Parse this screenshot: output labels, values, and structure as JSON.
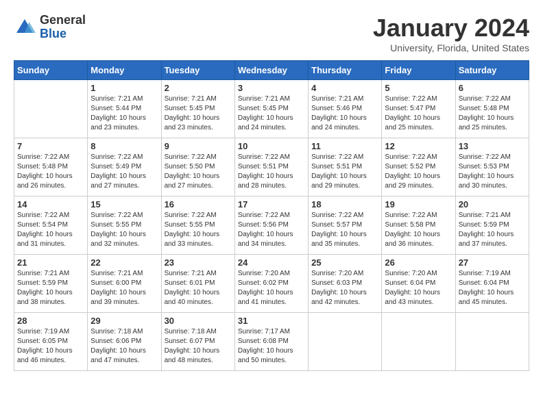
{
  "logo": {
    "general": "General",
    "blue": "Blue"
  },
  "header": {
    "title": "January 2024",
    "subtitle": "University, Florida, United States"
  },
  "days_of_week": [
    "Sunday",
    "Monday",
    "Tuesday",
    "Wednesday",
    "Thursday",
    "Friday",
    "Saturday"
  ],
  "weeks": [
    [
      {
        "day": "",
        "info": ""
      },
      {
        "day": "1",
        "info": "Sunrise: 7:21 AM\nSunset: 5:44 PM\nDaylight: 10 hours\nand 23 minutes."
      },
      {
        "day": "2",
        "info": "Sunrise: 7:21 AM\nSunset: 5:45 PM\nDaylight: 10 hours\nand 23 minutes."
      },
      {
        "day": "3",
        "info": "Sunrise: 7:21 AM\nSunset: 5:45 PM\nDaylight: 10 hours\nand 24 minutes."
      },
      {
        "day": "4",
        "info": "Sunrise: 7:21 AM\nSunset: 5:46 PM\nDaylight: 10 hours\nand 24 minutes."
      },
      {
        "day": "5",
        "info": "Sunrise: 7:22 AM\nSunset: 5:47 PM\nDaylight: 10 hours\nand 25 minutes."
      },
      {
        "day": "6",
        "info": "Sunrise: 7:22 AM\nSunset: 5:48 PM\nDaylight: 10 hours\nand 25 minutes."
      }
    ],
    [
      {
        "day": "7",
        "info": "Sunrise: 7:22 AM\nSunset: 5:48 PM\nDaylight: 10 hours\nand 26 minutes."
      },
      {
        "day": "8",
        "info": "Sunrise: 7:22 AM\nSunset: 5:49 PM\nDaylight: 10 hours\nand 27 minutes."
      },
      {
        "day": "9",
        "info": "Sunrise: 7:22 AM\nSunset: 5:50 PM\nDaylight: 10 hours\nand 27 minutes."
      },
      {
        "day": "10",
        "info": "Sunrise: 7:22 AM\nSunset: 5:51 PM\nDaylight: 10 hours\nand 28 minutes."
      },
      {
        "day": "11",
        "info": "Sunrise: 7:22 AM\nSunset: 5:51 PM\nDaylight: 10 hours\nand 29 minutes."
      },
      {
        "day": "12",
        "info": "Sunrise: 7:22 AM\nSunset: 5:52 PM\nDaylight: 10 hours\nand 29 minutes."
      },
      {
        "day": "13",
        "info": "Sunrise: 7:22 AM\nSunset: 5:53 PM\nDaylight: 10 hours\nand 30 minutes."
      }
    ],
    [
      {
        "day": "14",
        "info": "Sunrise: 7:22 AM\nSunset: 5:54 PM\nDaylight: 10 hours\nand 31 minutes."
      },
      {
        "day": "15",
        "info": "Sunrise: 7:22 AM\nSunset: 5:55 PM\nDaylight: 10 hours\nand 32 minutes."
      },
      {
        "day": "16",
        "info": "Sunrise: 7:22 AM\nSunset: 5:55 PM\nDaylight: 10 hours\nand 33 minutes."
      },
      {
        "day": "17",
        "info": "Sunrise: 7:22 AM\nSunset: 5:56 PM\nDaylight: 10 hours\nand 34 minutes."
      },
      {
        "day": "18",
        "info": "Sunrise: 7:22 AM\nSunset: 5:57 PM\nDaylight: 10 hours\nand 35 minutes."
      },
      {
        "day": "19",
        "info": "Sunrise: 7:22 AM\nSunset: 5:58 PM\nDaylight: 10 hours\nand 36 minutes."
      },
      {
        "day": "20",
        "info": "Sunrise: 7:21 AM\nSunset: 5:59 PM\nDaylight: 10 hours\nand 37 minutes."
      }
    ],
    [
      {
        "day": "21",
        "info": "Sunrise: 7:21 AM\nSunset: 5:59 PM\nDaylight: 10 hours\nand 38 minutes."
      },
      {
        "day": "22",
        "info": "Sunrise: 7:21 AM\nSunset: 6:00 PM\nDaylight: 10 hours\nand 39 minutes."
      },
      {
        "day": "23",
        "info": "Sunrise: 7:21 AM\nSunset: 6:01 PM\nDaylight: 10 hours\nand 40 minutes."
      },
      {
        "day": "24",
        "info": "Sunrise: 7:20 AM\nSunset: 6:02 PM\nDaylight: 10 hours\nand 41 minutes."
      },
      {
        "day": "25",
        "info": "Sunrise: 7:20 AM\nSunset: 6:03 PM\nDaylight: 10 hours\nand 42 minutes."
      },
      {
        "day": "26",
        "info": "Sunrise: 7:20 AM\nSunset: 6:04 PM\nDaylight: 10 hours\nand 43 minutes."
      },
      {
        "day": "27",
        "info": "Sunrise: 7:19 AM\nSunset: 6:04 PM\nDaylight: 10 hours\nand 45 minutes."
      }
    ],
    [
      {
        "day": "28",
        "info": "Sunrise: 7:19 AM\nSunset: 6:05 PM\nDaylight: 10 hours\nand 46 minutes."
      },
      {
        "day": "29",
        "info": "Sunrise: 7:18 AM\nSunset: 6:06 PM\nDaylight: 10 hours\nand 47 minutes."
      },
      {
        "day": "30",
        "info": "Sunrise: 7:18 AM\nSunset: 6:07 PM\nDaylight: 10 hours\nand 48 minutes."
      },
      {
        "day": "31",
        "info": "Sunrise: 7:17 AM\nSunset: 6:08 PM\nDaylight: 10 hours\nand 50 minutes."
      },
      {
        "day": "",
        "info": ""
      },
      {
        "day": "",
        "info": ""
      },
      {
        "day": "",
        "info": ""
      }
    ]
  ]
}
